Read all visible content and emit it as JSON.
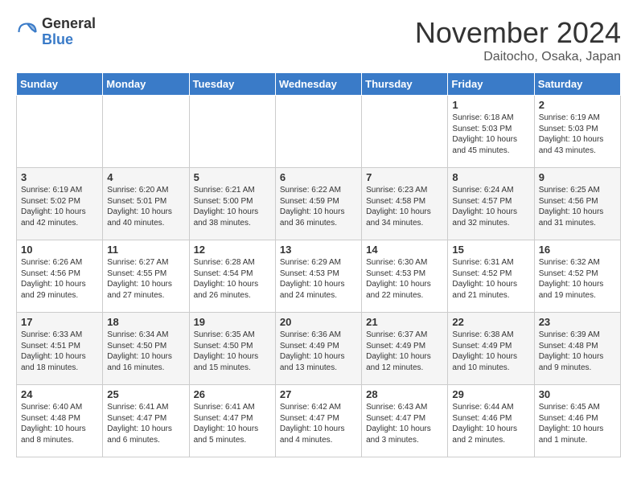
{
  "logo": {
    "general": "General",
    "blue": "Blue"
  },
  "title": "November 2024",
  "location": "Daitocho, Osaka, Japan",
  "headers": [
    "Sunday",
    "Monday",
    "Tuesday",
    "Wednesday",
    "Thursday",
    "Friday",
    "Saturday"
  ],
  "weeks": [
    [
      {
        "day": "",
        "info": ""
      },
      {
        "day": "",
        "info": ""
      },
      {
        "day": "",
        "info": ""
      },
      {
        "day": "",
        "info": ""
      },
      {
        "day": "",
        "info": ""
      },
      {
        "day": "1",
        "info": "Sunrise: 6:18 AM\nSunset: 5:03 PM\nDaylight: 10 hours\nand 45 minutes."
      },
      {
        "day": "2",
        "info": "Sunrise: 6:19 AM\nSunset: 5:03 PM\nDaylight: 10 hours\nand 43 minutes."
      }
    ],
    [
      {
        "day": "3",
        "info": "Sunrise: 6:19 AM\nSunset: 5:02 PM\nDaylight: 10 hours\nand 42 minutes."
      },
      {
        "day": "4",
        "info": "Sunrise: 6:20 AM\nSunset: 5:01 PM\nDaylight: 10 hours\nand 40 minutes."
      },
      {
        "day": "5",
        "info": "Sunrise: 6:21 AM\nSunset: 5:00 PM\nDaylight: 10 hours\nand 38 minutes."
      },
      {
        "day": "6",
        "info": "Sunrise: 6:22 AM\nSunset: 4:59 PM\nDaylight: 10 hours\nand 36 minutes."
      },
      {
        "day": "7",
        "info": "Sunrise: 6:23 AM\nSunset: 4:58 PM\nDaylight: 10 hours\nand 34 minutes."
      },
      {
        "day": "8",
        "info": "Sunrise: 6:24 AM\nSunset: 4:57 PM\nDaylight: 10 hours\nand 32 minutes."
      },
      {
        "day": "9",
        "info": "Sunrise: 6:25 AM\nSunset: 4:56 PM\nDaylight: 10 hours\nand 31 minutes."
      }
    ],
    [
      {
        "day": "10",
        "info": "Sunrise: 6:26 AM\nSunset: 4:56 PM\nDaylight: 10 hours\nand 29 minutes."
      },
      {
        "day": "11",
        "info": "Sunrise: 6:27 AM\nSunset: 4:55 PM\nDaylight: 10 hours\nand 27 minutes."
      },
      {
        "day": "12",
        "info": "Sunrise: 6:28 AM\nSunset: 4:54 PM\nDaylight: 10 hours\nand 26 minutes."
      },
      {
        "day": "13",
        "info": "Sunrise: 6:29 AM\nSunset: 4:53 PM\nDaylight: 10 hours\nand 24 minutes."
      },
      {
        "day": "14",
        "info": "Sunrise: 6:30 AM\nSunset: 4:53 PM\nDaylight: 10 hours\nand 22 minutes."
      },
      {
        "day": "15",
        "info": "Sunrise: 6:31 AM\nSunset: 4:52 PM\nDaylight: 10 hours\nand 21 minutes."
      },
      {
        "day": "16",
        "info": "Sunrise: 6:32 AM\nSunset: 4:52 PM\nDaylight: 10 hours\nand 19 minutes."
      }
    ],
    [
      {
        "day": "17",
        "info": "Sunrise: 6:33 AM\nSunset: 4:51 PM\nDaylight: 10 hours\nand 18 minutes."
      },
      {
        "day": "18",
        "info": "Sunrise: 6:34 AM\nSunset: 4:50 PM\nDaylight: 10 hours\nand 16 minutes."
      },
      {
        "day": "19",
        "info": "Sunrise: 6:35 AM\nSunset: 4:50 PM\nDaylight: 10 hours\nand 15 minutes."
      },
      {
        "day": "20",
        "info": "Sunrise: 6:36 AM\nSunset: 4:49 PM\nDaylight: 10 hours\nand 13 minutes."
      },
      {
        "day": "21",
        "info": "Sunrise: 6:37 AM\nSunset: 4:49 PM\nDaylight: 10 hours\nand 12 minutes."
      },
      {
        "day": "22",
        "info": "Sunrise: 6:38 AM\nSunset: 4:49 PM\nDaylight: 10 hours\nand 10 minutes."
      },
      {
        "day": "23",
        "info": "Sunrise: 6:39 AM\nSunset: 4:48 PM\nDaylight: 10 hours\nand 9 minutes."
      }
    ],
    [
      {
        "day": "24",
        "info": "Sunrise: 6:40 AM\nSunset: 4:48 PM\nDaylight: 10 hours\nand 8 minutes."
      },
      {
        "day": "25",
        "info": "Sunrise: 6:41 AM\nSunset: 4:47 PM\nDaylight: 10 hours\nand 6 minutes."
      },
      {
        "day": "26",
        "info": "Sunrise: 6:41 AM\nSunset: 4:47 PM\nDaylight: 10 hours\nand 5 minutes."
      },
      {
        "day": "27",
        "info": "Sunrise: 6:42 AM\nSunset: 4:47 PM\nDaylight: 10 hours\nand 4 minutes."
      },
      {
        "day": "28",
        "info": "Sunrise: 6:43 AM\nSunset: 4:47 PM\nDaylight: 10 hours\nand 3 minutes."
      },
      {
        "day": "29",
        "info": "Sunrise: 6:44 AM\nSunset: 4:46 PM\nDaylight: 10 hours\nand 2 minutes."
      },
      {
        "day": "30",
        "info": "Sunrise: 6:45 AM\nSunset: 4:46 PM\nDaylight: 10 hours\nand 1 minute."
      }
    ]
  ]
}
